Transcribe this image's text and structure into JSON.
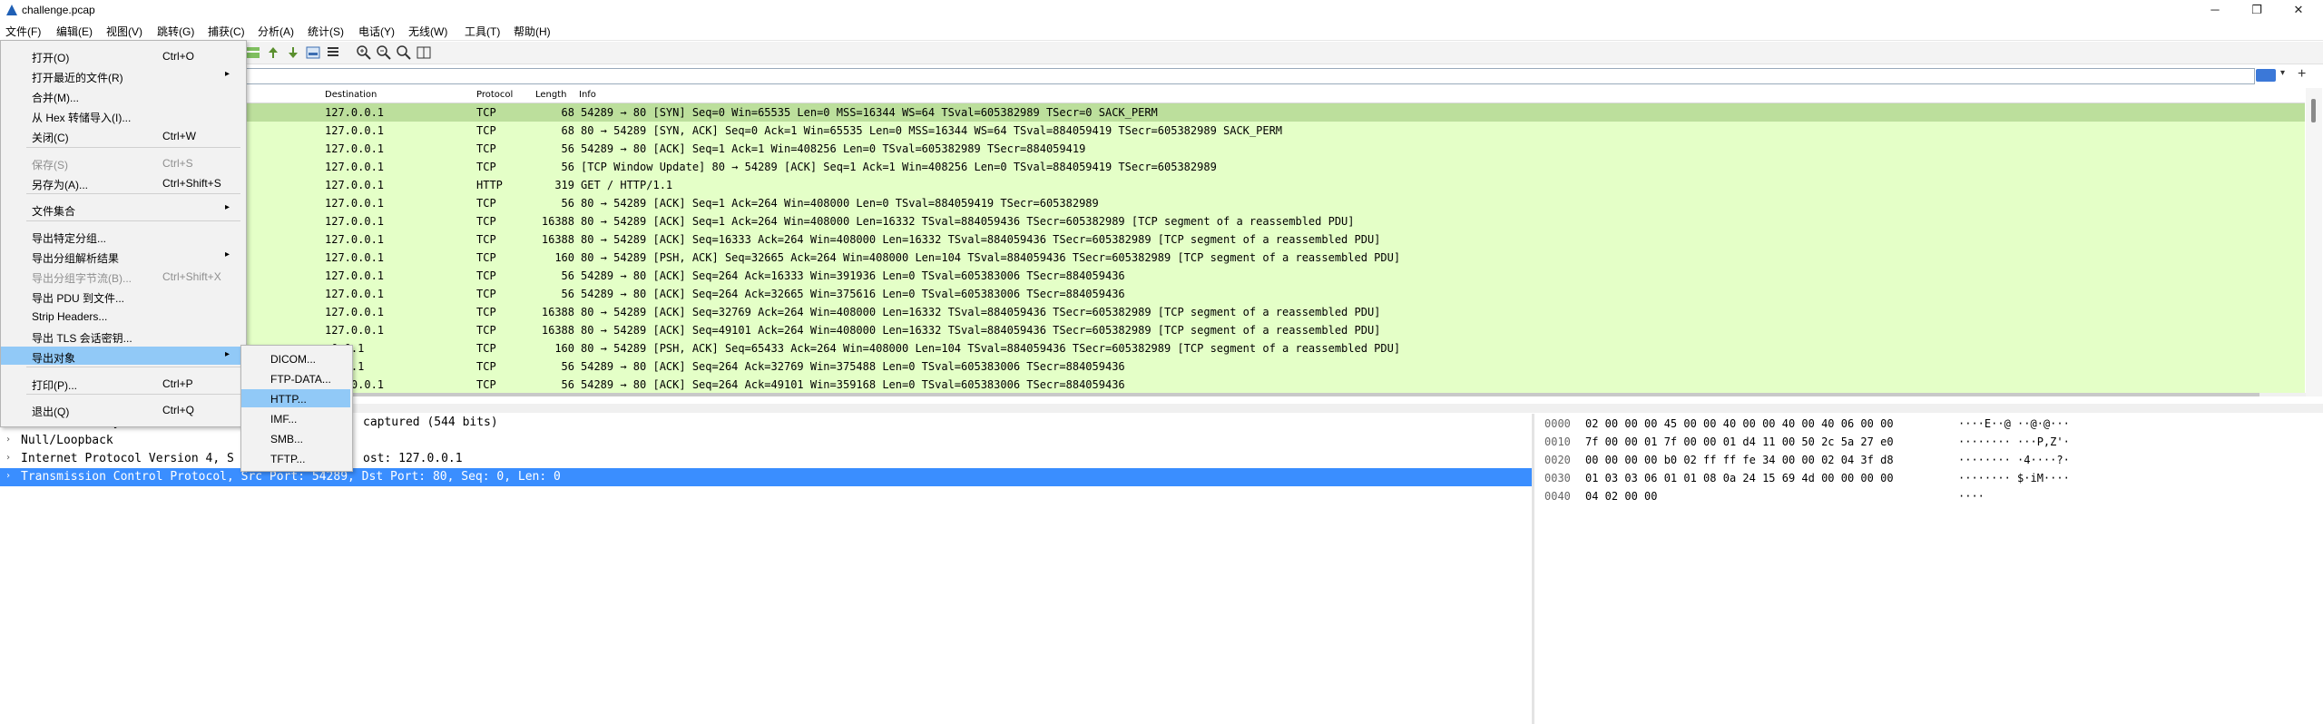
{
  "window": {
    "title": "challenge.pcap"
  },
  "menubar": [
    "文件(F)",
    "编辑(E)",
    "视图(V)",
    "跳转(G)",
    "捕获(C)",
    "分析(A)",
    "统计(S)",
    "电话(Y)",
    "无线(W)",
    "工具(T)",
    "帮助(H)"
  ],
  "file_menu": [
    {
      "label": "打开(O)",
      "shortcut": "Ctrl+O"
    },
    {
      "label": "打开最近的文件(R)",
      "shortcut": "",
      "submenu": "▸"
    },
    {
      "label": "合并(M)...",
      "shortcut": ""
    },
    {
      "label": "从 Hex 转储导入(I)...",
      "shortcut": ""
    },
    {
      "label": "关闭(C)",
      "shortcut": "Ctrl+W"
    },
    {
      "label": "保存(S)",
      "shortcut": "Ctrl+S",
      "disabled": true
    },
    {
      "label": "另存为(A)...",
      "shortcut": "Ctrl+Shift+S"
    },
    {
      "label": "文件集合",
      "shortcut": "",
      "submenu": "▸"
    },
    {
      "label": "导出特定分组...",
      "shortcut": ""
    },
    {
      "label": "导出分组解析结果",
      "shortcut": "",
      "submenu": "▸"
    },
    {
      "label": "导出分组字节流(B)...",
      "shortcut": "Ctrl+Shift+X",
      "disabled": true
    },
    {
      "label": "导出 PDU 到文件...",
      "shortcut": ""
    },
    {
      "label": "Strip Headers...",
      "shortcut": ""
    },
    {
      "label": "导出 TLS 会话密钥...",
      "shortcut": ""
    },
    {
      "label": "导出对象",
      "shortcut": "",
      "submenu": "▸",
      "highlighted": true
    },
    {
      "label": "打印(P)...",
      "shortcut": "Ctrl+P"
    },
    {
      "label": "退出(Q)",
      "shortcut": "Ctrl+Q"
    }
  ],
  "export_objects_submenu": [
    "DICOM...",
    "FTP-DATA...",
    "HTTP...",
    "IMF...",
    "SMB...",
    "TFTP..."
  ],
  "packet_list": {
    "columns": {
      "destination": "Destination",
      "protocol": "Protocol",
      "length": "Length",
      "info": "Info"
    },
    "rows": [
      {
        "dst": "127.0.0.1",
        "proto": "TCP",
        "len": "68",
        "info": "54289 → 80 [SYN] Seq=0 Win=65535 Len=0 MSS=16344 WS=64 TSval=605382989 TSecr=0 SACK_PERM"
      },
      {
        "dst": "127.0.0.1",
        "proto": "TCP",
        "len": "68",
        "info": "80 → 54289 [SYN, ACK] Seq=0 Ack=1 Win=65535 Len=0 MSS=16344 WS=64 TSval=884059419 TSecr=605382989 SACK_PERM"
      },
      {
        "dst": "127.0.0.1",
        "proto": "TCP",
        "len": "56",
        "info": "54289 → 80 [ACK] Seq=1 Ack=1 Win=408256 Len=0 TSval=605382989 TSecr=884059419"
      },
      {
        "dst": "127.0.0.1",
        "proto": "TCP",
        "len": "56",
        "info": "[TCP Window Update] 80 → 54289 [ACK] Seq=1 Ack=1 Win=408256 Len=0 TSval=884059419 TSecr=605382989"
      },
      {
        "dst": "127.0.0.1",
        "proto": "HTTP",
        "len": "319",
        "info": "GET / HTTP/1.1"
      },
      {
        "dst": "127.0.0.1",
        "proto": "TCP",
        "len": "56",
        "info": "80 → 54289 [ACK] Seq=1 Ack=264 Win=408000 Len=0 TSval=884059419 TSecr=605382989"
      },
      {
        "dst": "127.0.0.1",
        "proto": "TCP",
        "len": "16388",
        "info": "80 → 54289 [ACK] Seq=1 Ack=264 Win=408000 Len=16332 TSval=884059436 TSecr=605382989 [TCP segment of a reassembled PDU]"
      },
      {
        "dst": "127.0.0.1",
        "proto": "TCP",
        "len": "16388",
        "info": "80 → 54289 [ACK] Seq=16333 Ack=264 Win=408000 Len=16332 TSval=884059436 TSecr=605382989 [TCP segment of a reassembled PDU]"
      },
      {
        "dst": "127.0.0.1",
        "proto": "TCP",
        "len": "160",
        "info": "80 → 54289 [PSH, ACK] Seq=32665 Ack=264 Win=408000 Len=104 TSval=884059436 TSecr=605382989 [TCP segment of a reassembled PDU]"
      },
      {
        "dst": "127.0.0.1",
        "proto": "TCP",
        "len": "56",
        "info": "54289 → 80 [ACK] Seq=264 Ack=16333 Win=391936 Len=0 TSval=605383006 TSecr=884059436"
      },
      {
        "dst": "127.0.0.1",
        "proto": "TCP",
        "len": "56",
        "info": "54289 → 80 [ACK] Seq=264 Ack=32665 Win=375616 Len=0 TSval=605383006 TSecr=884059436"
      },
      {
        "dst": "127.0.0.1",
        "proto": "TCP",
        "len": "16388",
        "info": "80 → 54289 [ACK] Seq=32769 Ack=264 Win=408000 Len=16332 TSval=884059436 TSecr=605382989 [TCP segment of a reassembled PDU]"
      },
      {
        "dst": "127.0.0.1",
        "proto": "TCP",
        "len": "16388",
        "info": "80 → 54289 [ACK] Seq=49101 Ack=264 Win=408000 Len=16332 TSval=884059436 TSecr=605382989 [TCP segment of a reassembled PDU]"
      },
      {
        "dst": ".0.0.1",
        "proto": "TCP",
        "len": "160",
        "info": "80 → 54289 [PSH, ACK] Seq=65433 Ack=264 Win=408000 Len=104 TSval=884059436 TSecr=605382989 [TCP segment of a reassembled PDU]"
      },
      {
        "dst": ".0.0.1",
        "proto": "TCP",
        "len": "56",
        "info": "54289 → 80 [ACK] Seq=264 Ack=32769 Win=375488 Len=0 TSval=605383006 TSecr=884059436"
      },
      {
        "dst": "127.0.0.1",
        "proto": "TCP",
        "len": "56",
        "info": "54289 → 80 [ACK] Seq=264 Ack=49101 Win=359168 Len=0 TSval=605383006 TSecr=884059436"
      }
    ]
  },
  "detail_tree": [
    "Frame 1: 68 bytes on wire (544",
    "Null/Loopback",
    "Internet Protocol Version 4, S",
    "Transmission Control Protocol, Src Port: 54289, Dst Port: 80, Seq: 0, Len: 0"
  ],
  "detail_tree_suffix": [
    "captured (544 bits)",
    "",
    "ost: 127.0.0.1",
    ""
  ],
  "hex_dump": [
    {
      "offset": "0000",
      "bytes": "02 00 00 00 45 00 00 40  00 00 40 00 40 06 00 00",
      "ascii": "····E··@ ··@·@···"
    },
    {
      "offset": "0010",
      "bytes": "7f 00 00 01 7f 00 00 01  d4 11 00 50 2c 5a 27 e0",
      "ascii": "········ ···P,Z'·"
    },
    {
      "offset": "0020",
      "bytes": "00 00 00 00 b0 02 ff ff  fe 34 00 00 02 04 3f d8",
      "ascii": "········ ·4····?·"
    },
    {
      "offset": "0030",
      "bytes": "01 03 03 06 01 01 08 0a  24 15 69 4d 00 00 00 00",
      "ascii": "········ $·iM····"
    },
    {
      "offset": "0040",
      "bytes": "04 02 00 00",
      "ascii": "····"
    }
  ],
  "colors": {
    "row_bg": "#e4ffc7",
    "selected_row": "#bcdf9c",
    "menu_highlight": "#91c9f7",
    "tree_selected": "#3a8eff"
  }
}
